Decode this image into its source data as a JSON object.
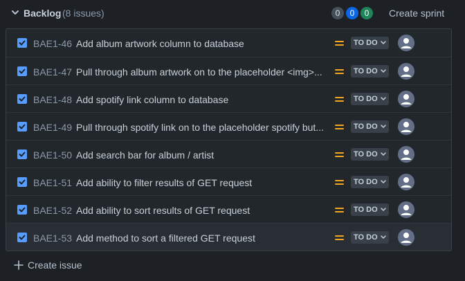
{
  "backlog": {
    "title": "Backlog",
    "count_text": "(8 issues)",
    "badges": [
      "0",
      "0",
      "0"
    ],
    "create_sprint_label": "Create sprint",
    "create_issue_label": "Create issue"
  },
  "colors": {
    "badge_gray": "#454f59",
    "badge_blue": "#0c66e4",
    "badge_green": "#1f845a",
    "checkbox": "#579dff",
    "priority_medium": "#f5a623"
  },
  "issues": [
    {
      "key": "BAE1-46",
      "summary": "Add album artwork column to database",
      "status": "TO DO",
      "checked": true
    },
    {
      "key": "BAE1-47",
      "summary": "Pull through album artwork on to the placeholder <img>...",
      "status": "TO DO",
      "checked": true
    },
    {
      "key": "BAE1-48",
      "summary": "Add spotify link column to database",
      "status": "TO DO",
      "checked": true
    },
    {
      "key": "BAE1-49",
      "summary": "Pull through spotify link on to the placeholder spotify but...",
      "status": "TO DO",
      "checked": true
    },
    {
      "key": "BAE1-50",
      "summary": "Add search bar for album / artist",
      "status": "TO DO",
      "checked": true
    },
    {
      "key": "BAE1-51",
      "summary": "Add ability to filter results of GET request",
      "status": "TO DO",
      "checked": true
    },
    {
      "key": "BAE1-52",
      "summary": "Add ability to sort results of GET request",
      "status": "TO DO",
      "checked": true
    },
    {
      "key": "BAE1-53",
      "summary": "Add method to sort a filtered GET request",
      "status": "TO DO",
      "checked": true
    }
  ]
}
